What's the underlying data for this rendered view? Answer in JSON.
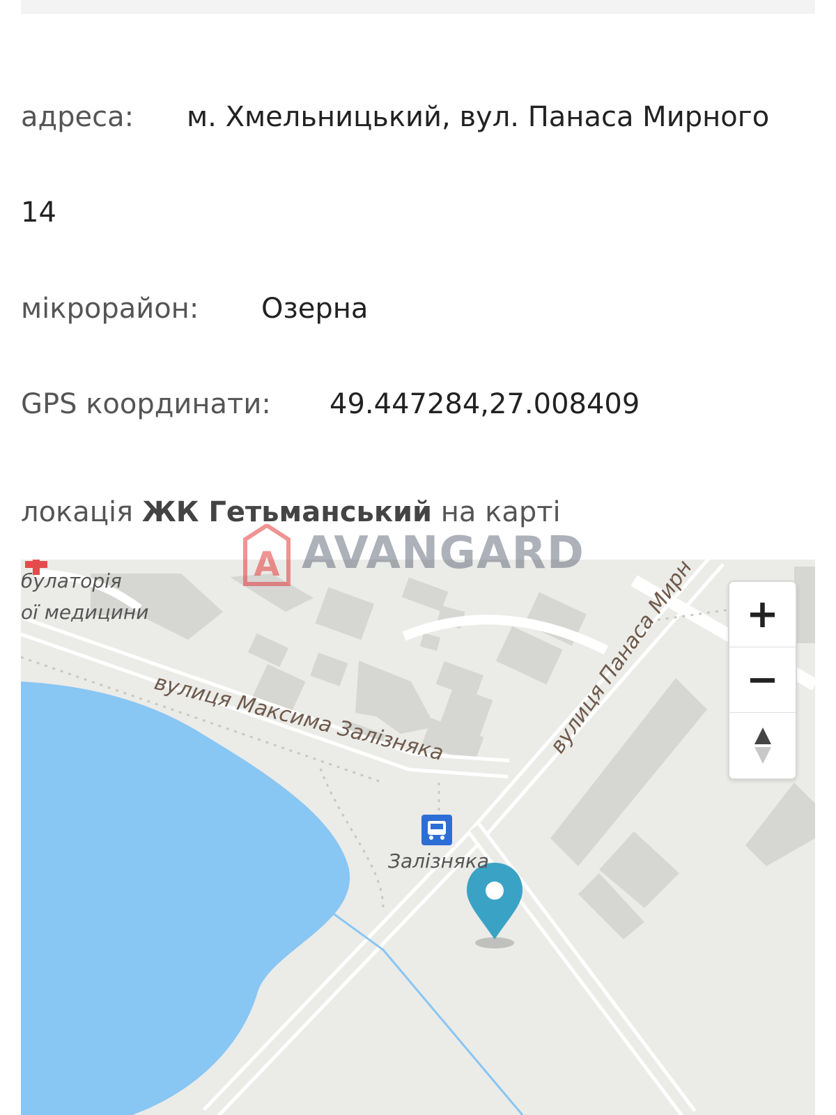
{
  "address": {
    "label": "адреса:",
    "value_line1": "м. Хмельницький, вул. Панаса Мирного",
    "value_line2": "14"
  },
  "district": {
    "label": "мікрорайон:",
    "value": "Озерна"
  },
  "gps": {
    "label": "GPS координати:",
    "value": "49.447284,27.008409"
  },
  "location": {
    "prefix": "локація",
    "complex": "ЖК Гетьманський",
    "suffix": "на карті"
  },
  "watermark": {
    "text": "AVANGARD",
    "accent": "#e23b3b"
  },
  "map": {
    "labels": {
      "clinic_line1": "булаторія",
      "clinic_line2": "ої медицини",
      "street_zaliznyaka": "вулиця Максима Залізняка",
      "street_myrnoho": "вулиця Панаса Мирн",
      "stop": "Залізняка"
    },
    "controls": {
      "zoom_in": "+",
      "zoom_out": "−",
      "north": "▲"
    },
    "colors": {
      "water": "#88c6f4",
      "marker": "#3aa3c5",
      "background": "#ebebe8",
      "building": "#d6d6d3"
    }
  }
}
